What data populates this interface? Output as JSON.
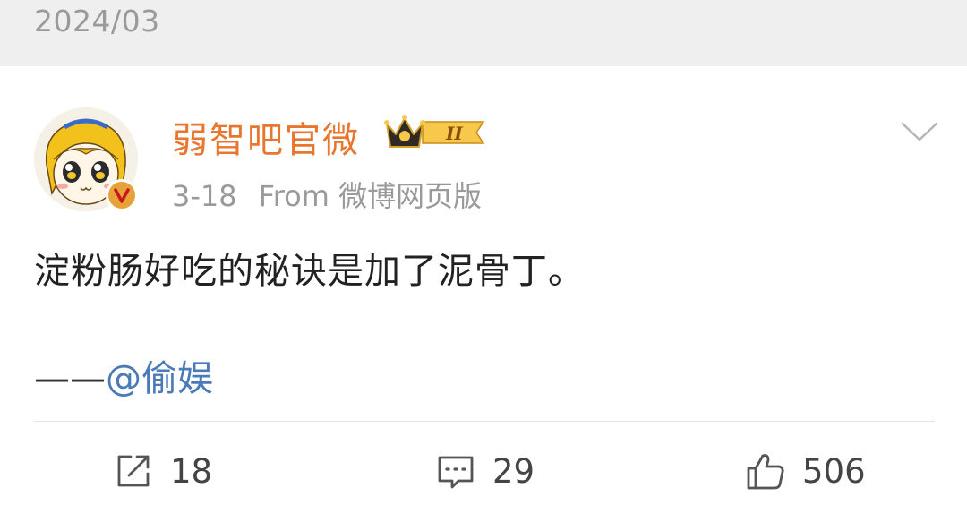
{
  "header": {
    "date": "2024/03"
  },
  "post": {
    "author": {
      "name": "弱智吧官微",
      "vip_level": "II"
    },
    "meta": {
      "time": "3-18",
      "source": "From 微博网页版"
    },
    "text": "淀粉肠好吃的秘诀是加了泥骨丁。",
    "credit": {
      "dash": "——",
      "mention": "@偷娱"
    }
  },
  "actions": {
    "repost": {
      "icon": "repost-icon",
      "count": "18"
    },
    "comment": {
      "icon": "comment-icon",
      "count": "29"
    },
    "like": {
      "icon": "thumbs-up-icon",
      "count": "506"
    }
  },
  "colors": {
    "username": "#e8762e",
    "mention": "#4a7ab8",
    "meta": "#9a9a9a",
    "header_bg": "#efefef"
  }
}
